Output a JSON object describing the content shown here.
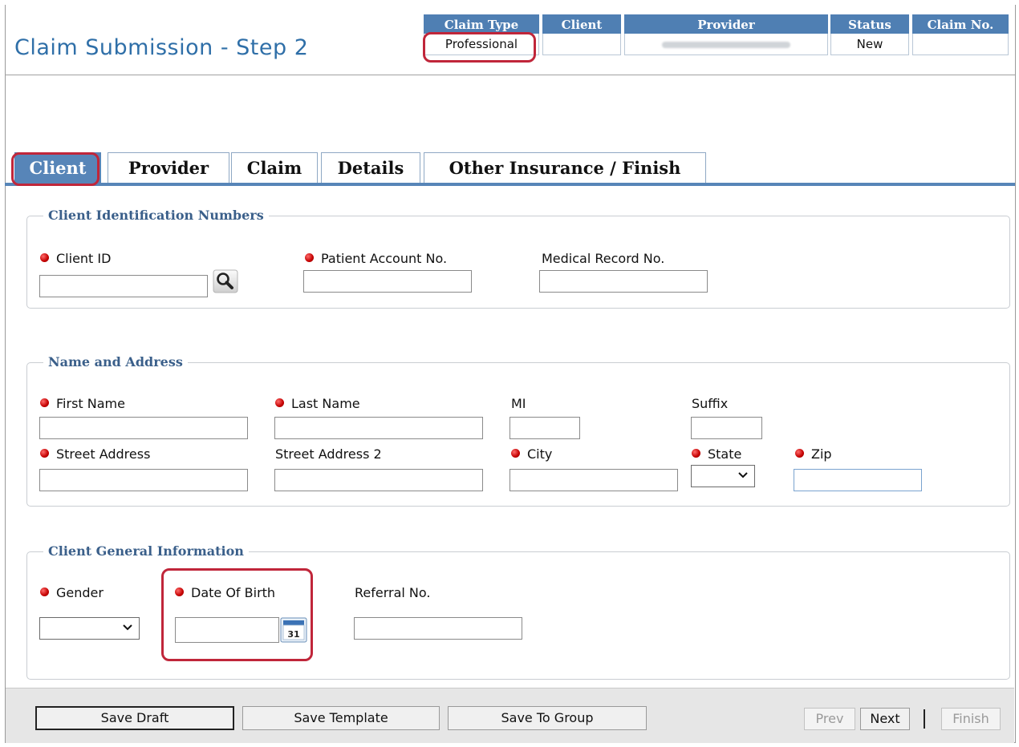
{
  "page": {
    "title": "Claim Submission - Step 2"
  },
  "summary": {
    "columns": [
      {
        "header": "Claim Type",
        "value": "Professional"
      },
      {
        "header": "Client",
        "value": ""
      },
      {
        "header": "Provider",
        "value": ""
      },
      {
        "header": "Status",
        "value": "New"
      },
      {
        "header": "Claim No.",
        "value": ""
      }
    ]
  },
  "tabs": [
    {
      "label": "Client",
      "active": true
    },
    {
      "label": "Provider"
    },
    {
      "label": "Claim"
    },
    {
      "label": "Details"
    },
    {
      "label": "Other Insurance / Finish"
    }
  ],
  "sections": {
    "identification": {
      "legend": "Client Identification Numbers",
      "client_id": "Client ID",
      "patient_account": "Patient Account No.",
      "medical_record": "Medical Record No."
    },
    "name_address": {
      "legend": "Name and Address",
      "first_name": "First Name",
      "last_name": "Last Name",
      "mi": "MI",
      "suffix": "Suffix",
      "street": "Street Address",
      "street2": "Street Address 2",
      "city": "City",
      "state": "State",
      "zip": "Zip"
    },
    "general": {
      "legend": "Client General Information",
      "gender": "Gender",
      "dob": "Date Of Birth",
      "referral": "Referral No.",
      "calendar_day": "31"
    }
  },
  "footer": {
    "save_draft": "Save Draft",
    "save_template": "Save Template",
    "save_group": "Save To Group",
    "prev": "Prev",
    "next": "Next",
    "finish": "Finish"
  },
  "colors": {
    "accent": "#5785b8",
    "title": "#2f6fa8",
    "required": "#c40000",
    "callout": "#c0263a"
  }
}
